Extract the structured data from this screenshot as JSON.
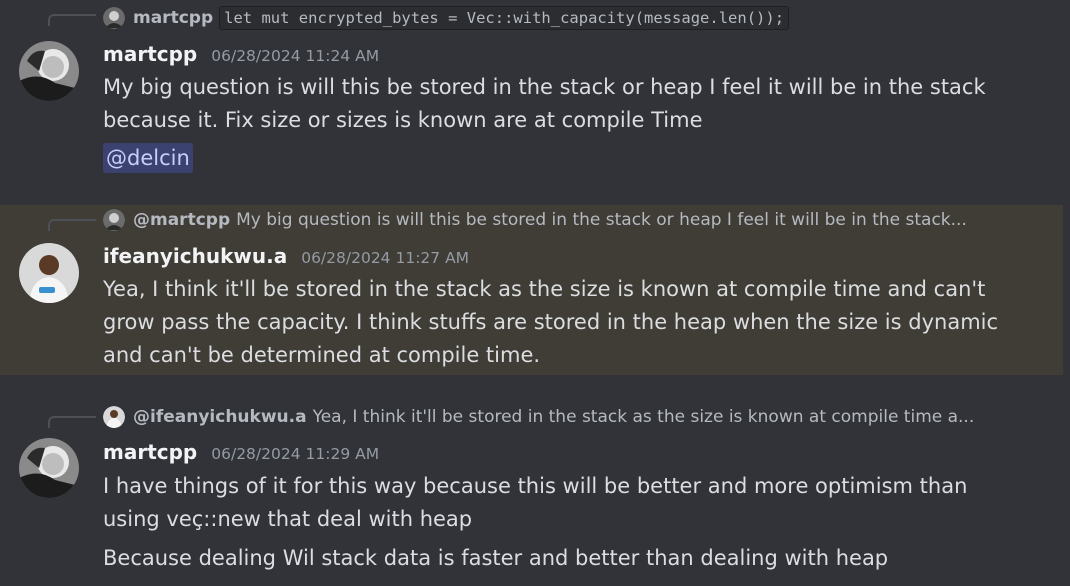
{
  "messages": [
    {
      "reply": {
        "author": "martcpp",
        "snippet": "let mut encrypted_bytes = Vec::with_capacity(message.len());"
      },
      "author": "martcpp",
      "timestamp": "06/28/2024 11:24 AM",
      "lines": [
        "My big question is will this be stored in the stack or heap I feel it will be in the stack",
        "because it. Fix size or sizes is known are at compile Time"
      ],
      "mention": "@delcin"
    },
    {
      "reply": {
        "author": "@martcpp",
        "snippet": "My big question is will this be stored in the stack or heap I feel it will be in the stack..."
      },
      "author": "ifeanyichukwu.a",
      "timestamp": "06/28/2024 11:27 AM",
      "lines": [
        "Yea, I think it'll be stored in the stack as the size is known at compile time and can't",
        "grow pass the capacity. I think stuffs are stored in the heap when the size is dynamic",
        "and can't be determined at compile time."
      ]
    },
    {
      "reply": {
        "author": "@ifeanyichukwu.a",
        "snippet": "Yea, I think it'll be stored in the stack as the size is known at compile time a..."
      },
      "author": "martcpp",
      "timestamp": "06/28/2024 11:29 AM",
      "lines": [
        "I have things of it for this way because this will be better and more optimism than",
        "using veç::new that deal with heap"
      ],
      "followup": "Because dealing Wil stack data is faster and better than dealing with heap"
    }
  ],
  "colors": {
    "background": "#313338",
    "highlight": "#403c36",
    "mention_bg": "#3c4270",
    "mention_text": "#c9cdfb"
  }
}
